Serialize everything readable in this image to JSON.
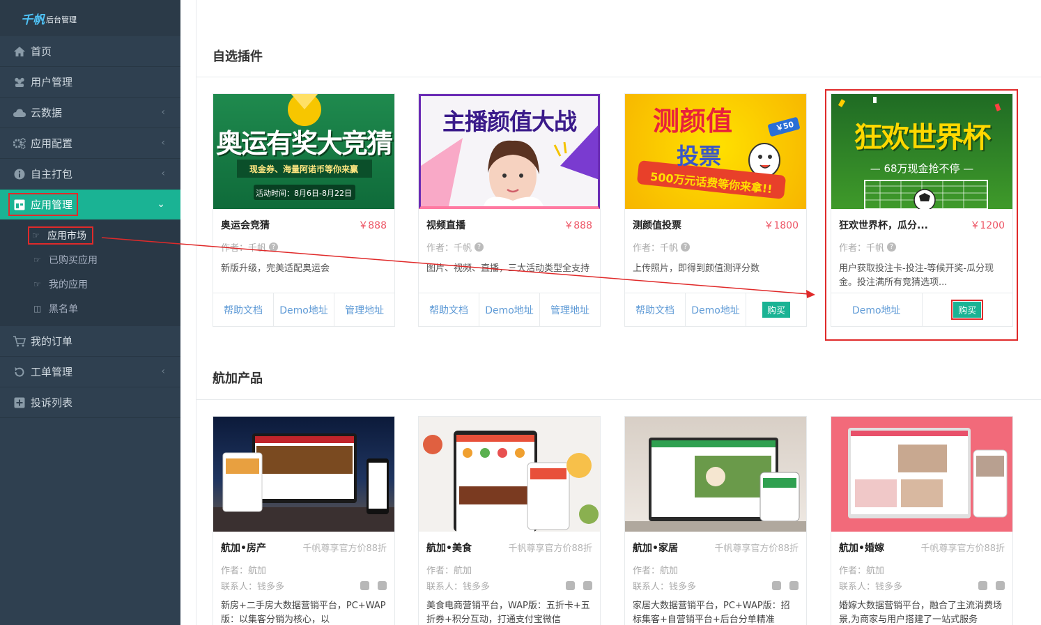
{
  "logo": {
    "brand": "千帆",
    "sub": "后台管理"
  },
  "nav": [
    {
      "label": "首页",
      "icon": "home-icon"
    },
    {
      "label": "用户管理",
      "icon": "users-icon"
    },
    {
      "label": "云数据",
      "icon": "cloud-icon"
    },
    {
      "label": "应用配置",
      "icon": "gears-icon"
    },
    {
      "label": "自主打包",
      "icon": "info-icon"
    },
    {
      "label": "应用管理",
      "icon": "window-icon"
    },
    {
      "label": "我的订单",
      "icon": "cart-icon"
    },
    {
      "label": "工单管理",
      "icon": "refresh-icon"
    },
    {
      "label": "投诉列表",
      "icon": "plus-square-icon"
    }
  ],
  "subnav": [
    {
      "label": "应用市场",
      "icon": "hand-icon"
    },
    {
      "label": "已购买应用",
      "icon": "hand-icon"
    },
    {
      "label": "我的应用",
      "icon": "hand-icon"
    },
    {
      "label": "黑名单",
      "icon": "square-icon"
    }
  ],
  "sections": {
    "plugins": "自选插件",
    "products": "航加产品"
  },
  "plugins": [
    {
      "banner_text": "奥运有奖大竞猜",
      "banner_sub": "现金券、海量阿诺币等你来赢",
      "banner_date": "活动时间：8月6日-8月22日",
      "name": "奥运会竞猜",
      "price": "￥888",
      "author": "作者：千帆",
      "desc": "新版升级，完美适配奥运会",
      "actions": [
        "帮助文档",
        "Demo地址",
        "管理地址"
      ]
    },
    {
      "banner_text": "主播颜值大战",
      "name": "视频直播",
      "price": "￥888",
      "author": "作者：千帆",
      "desc": "图片、视频、直播，三大活动类型全支持",
      "actions": [
        "帮助文档",
        "Demo地址",
        "管理地址"
      ]
    },
    {
      "banner_text": "测颜值",
      "banner_text2": "投票",
      "banner_sub": "500万元话费等你来拿!!",
      "banner_tag": "￥50",
      "name": "测颜值投票",
      "price": "￥1800",
      "author": "作者：千帆",
      "desc": "上传照片，即得到颜值测评分数",
      "actions": [
        "帮助文档",
        "Demo地址",
        "购买"
      ]
    },
    {
      "banner_text": "狂欢世界杯",
      "banner_sub": "— 68万现金抢不停 —",
      "name": "狂欢世界杯，瓜分...",
      "price": "￥1200",
      "author": "作者：千帆",
      "desc": "用户获取投注卡-投注-等候开奖-瓜分现金。投注满所有竞猜选项...",
      "actions": [
        "Demo地址",
        "购买"
      ]
    }
  ],
  "products": [
    {
      "name": "航加•房产",
      "discount": "千帆尊享官方价88折",
      "author": "作者：航加",
      "contact": "联系人：钱多多",
      "desc": "新房+二手房大数据营销平台，PC+WAP版：以集客分销为核心，以"
    },
    {
      "name": "航加•美食",
      "discount": "千帆尊享官方价88折",
      "author": "作者：航加",
      "contact": "联系人：钱多多",
      "desc": "美食电商营销平台，WAP版：五折卡+五折券+积分互动，打通支付宝微信"
    },
    {
      "name": "航加•家居",
      "discount": "千帆尊享官方价88折",
      "author": "作者：航加",
      "contact": "联系人：钱多多",
      "desc": "家居大数据营销平台，PC+WAP版：招标集客+自营销平台+后台分单精准"
    },
    {
      "name": "航加•婚嫁",
      "discount": "千帆尊享官方价88折",
      "author": "作者：航加",
      "contact": "联系人：钱多多",
      "desc": "婚嫁大数据营销平台，融合了主流消费场景,为商家与用户搭建了一站式服务"
    }
  ],
  "colors": {
    "sidebar": "#2f4050",
    "accent": "#1ab394",
    "price": "#ed5565",
    "link": "#5e9ad6",
    "annotation": "#e02a2a"
  }
}
